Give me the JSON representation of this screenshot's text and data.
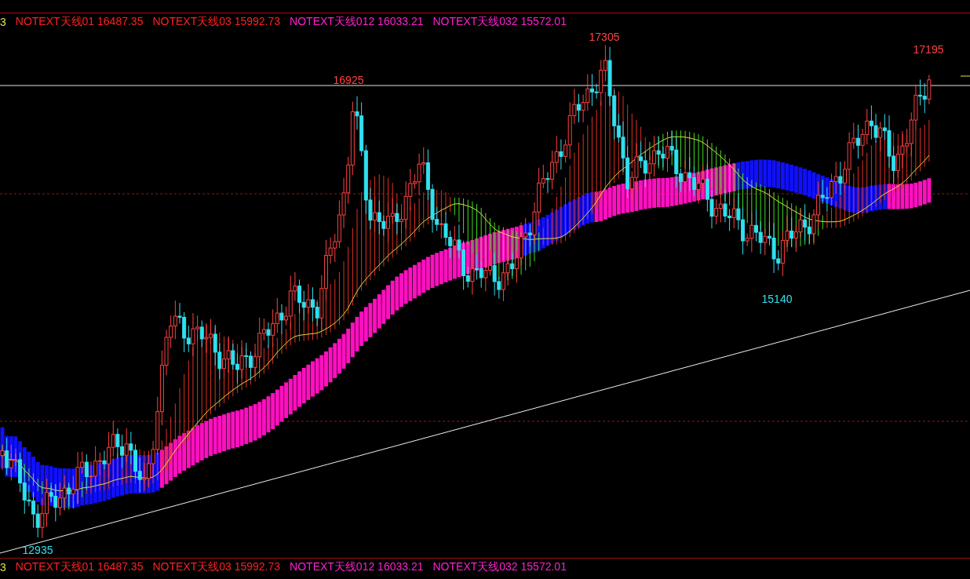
{
  "legend_top": {
    "prefix": "3",
    "items": [
      {
        "label": "NOTEXT天线01",
        "value": "16487.35",
        "color": "#ff2020"
      },
      {
        "label": "NOTEXT天线03",
        "value": "15992.73",
        "color": "#ff2020"
      },
      {
        "label": "NOTEXT天线012",
        "value": "16033.21",
        "color": "#ff20d0"
      },
      {
        "label": "NOTEXT天线032",
        "value": "15572.01",
        "color": "#ff20d0"
      }
    ]
  },
  "price_labels": [
    {
      "text": "16925",
      "kind": "high"
    },
    {
      "text": "17305",
      "kind": "high"
    },
    {
      "text": "17195",
      "kind": "high"
    },
    {
      "text": "15140",
      "kind": "low"
    },
    {
      "text": "12935",
      "kind": "low"
    }
  ],
  "legend_bottom": {
    "prefix": "3",
    "items": [
      {
        "label": "NOTEXT天线01",
        "value": "16487.35",
        "color": "#ff2020"
      },
      {
        "label": "NOTEXT天线03",
        "value": "15992.73",
        "color": "#ff2020"
      },
      {
        "label": "NOTEXT天线012",
        "value": "16033.21",
        "color": "#ff20d0"
      },
      {
        "label": "NOTEXT天线032",
        "value": "15572.01",
        "color": "#ff20d0"
      }
    ]
  }
}
